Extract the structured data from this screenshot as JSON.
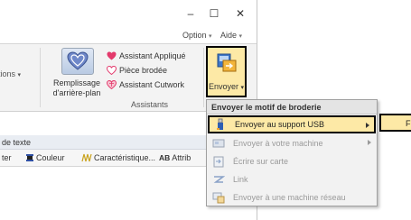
{
  "window": {
    "minimize": "–",
    "maximize": "☐",
    "close": "✕"
  },
  "ribbon_tabs": {
    "option": "Option",
    "aide": "Aide"
  },
  "ribbon": {
    "cut_label": "tions",
    "fill_button": "Remplissage d'arrière-plan",
    "assistants": {
      "applique": "Assistant Appliqué",
      "piece": "Pièce brodée",
      "cutwork": "Assistant Cutwork"
    },
    "group_label": "Assistants",
    "send_button": "Envoyer"
  },
  "panel": {
    "title": "de texte"
  },
  "toolbar": {
    "trim": "ter",
    "color": "Couleur",
    "characteristic": "Caractéristique...",
    "attr": "Attrib",
    "ab": "AB"
  },
  "menu": {
    "title": "Envoyer le motif de broderie",
    "items": [
      {
        "label": "Envoyer au support USB",
        "icon": "usb-icon",
        "enabled": true,
        "has_submenu": true
      },
      {
        "label": "Envoyer à votre machine",
        "icon": "machine-icon",
        "enabled": false,
        "has_submenu": true
      },
      {
        "label": "Écrire sur carte",
        "icon": "card-icon",
        "enabled": false,
        "has_submenu": false
      },
      {
        "label": "Link",
        "icon": "link-icon",
        "enabled": false,
        "has_submenu": false
      },
      {
        "label": "Envoyer à une machine réseau",
        "icon": "network-icon",
        "enabled": false,
        "has_submenu": false
      }
    ],
    "submenu_item": "F:"
  },
  "colors": {
    "highlight": "#fde9a6",
    "border": "#000000",
    "accent_heart": "#e33a6c"
  }
}
